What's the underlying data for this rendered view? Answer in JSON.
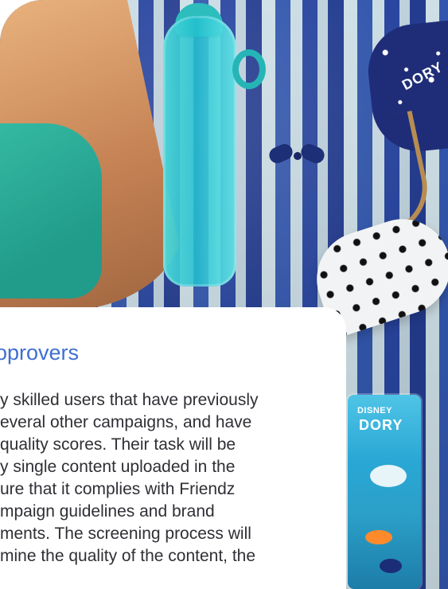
{
  "card": {
    "title": "oprovers",
    "body_lines": [
      "y skilled users that have previously",
      "everal other campaigns, and have",
      "quality scores. Their task will be",
      "y single content uploaded in the",
      "ure that it complies with Friendz",
      "mpaign guidelines and brand",
      "ments. The screening process will",
      "mine the quality of the content, the"
    ]
  },
  "photo": {
    "toy_label": "DORY",
    "card_title": "Disney",
    "card_subtitle": "DORY"
  },
  "colors": {
    "title": "#3f6fd0",
    "body": "#2f2f35",
    "background": "#ffffff"
  }
}
